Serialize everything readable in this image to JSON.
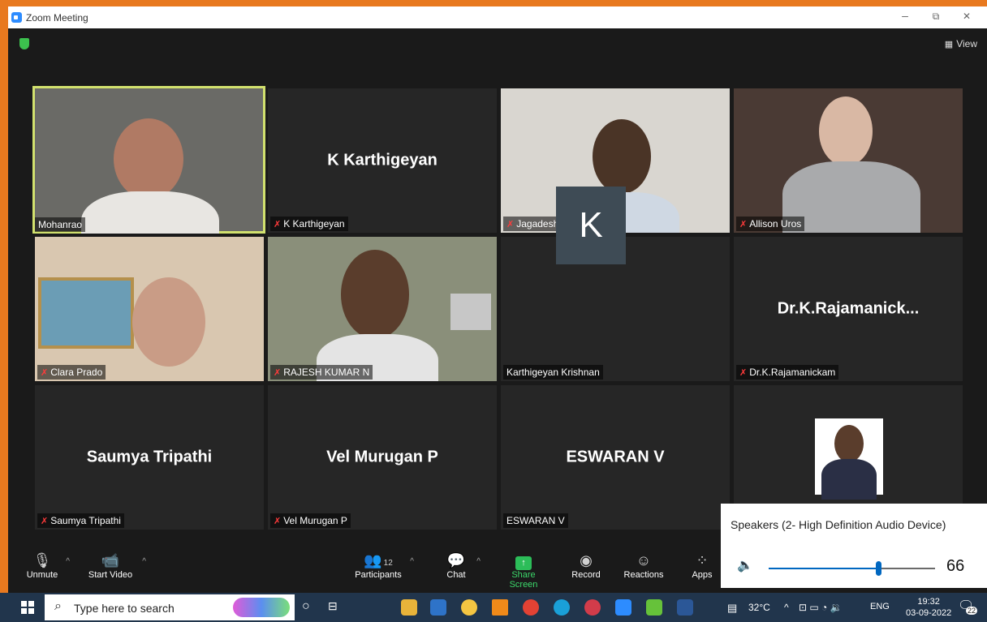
{
  "window": {
    "title": "Zoom Meeting",
    "minimize": "–",
    "maximize": "⧉",
    "close": "✕"
  },
  "topbar": {
    "view_label": "View",
    "view_icon": "▦"
  },
  "tiles": [
    {
      "label": "Mohanrao",
      "muted": false,
      "has_video": true,
      "active": true
    },
    {
      "label": "K Karthigeyan",
      "muted": true,
      "has_video": false,
      "big_name": "K Karthigeyan"
    },
    {
      "label": "Jagadesh M",
      "muted": true,
      "has_video": true
    },
    {
      "label": "Allison Uros",
      "muted": true,
      "has_video": true
    },
    {
      "label": "Clara Prado",
      "muted": true,
      "has_video": true
    },
    {
      "label": "RAJESH KUMAR N",
      "muted": true,
      "has_video": true
    },
    {
      "label": "Karthigeyan Krishnan",
      "muted": false,
      "has_video": false,
      "avatar_letter": "K"
    },
    {
      "label": "Dr.K.Rajamanickam",
      "muted": true,
      "has_video": false,
      "big_name": "Dr.K.Rajamanick..."
    },
    {
      "label": "Saumya Tripathi",
      "muted": true,
      "has_video": false,
      "big_name": "Saumya Tripathi"
    },
    {
      "label": "Vel Murugan P",
      "muted": true,
      "has_video": false,
      "big_name": "Vel Murugan P"
    },
    {
      "label": "ESWARAN V",
      "muted": false,
      "has_video": false,
      "big_name": "ESWARAN V"
    },
    {
      "label": "",
      "muted": false,
      "has_video": false,
      "profile_photo": true
    }
  ],
  "controls": {
    "unmute": "Unmute",
    "start_video": "Start Video",
    "participants": "Participants",
    "participants_count": "12",
    "chat": "Chat",
    "share_screen": "Share Screen",
    "record": "Record",
    "reactions": "Reactions",
    "apps": "Apps"
  },
  "volume_popup": {
    "device": "Speakers (2- High Definition Audio Device)",
    "level": 66
  },
  "taskbar": {
    "search_placeholder": "Type here to search",
    "temperature": "32°C",
    "language": "ENG",
    "time": "19:32",
    "date": "03-09-2022",
    "notifications": "22"
  },
  "colors": {
    "accent_green": "#3cd76a",
    "active_border": "#d2e16e",
    "taskbar": "#21354c",
    "frame": "#e8791f"
  }
}
